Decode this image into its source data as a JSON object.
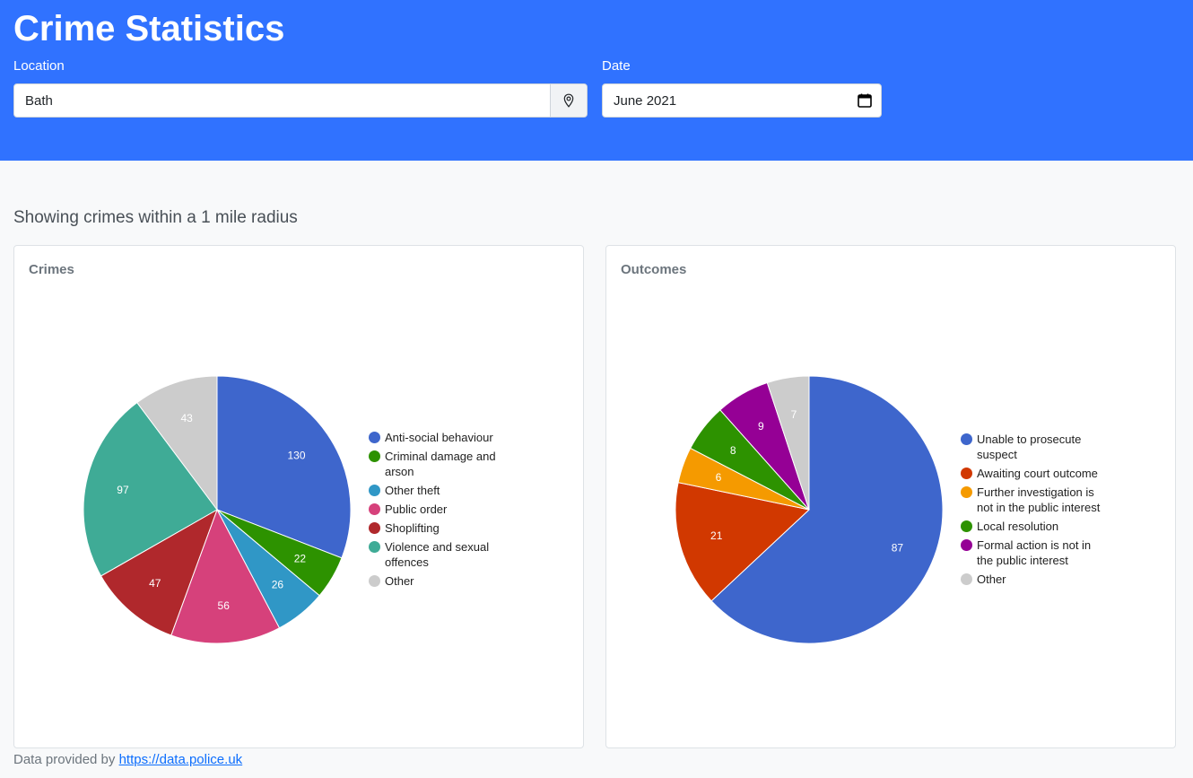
{
  "header": {
    "title": "Crime Statistics",
    "location_label": "Location",
    "location_value": "Bath",
    "date_label": "Date",
    "date_value": "June 2021"
  },
  "main": {
    "subtitle": "Showing crimes within a 1 mile radius"
  },
  "footer": {
    "text": "Data provided by",
    "link_text": "https://data.police.uk"
  },
  "icons": {
    "location": "map-pin-icon",
    "date": "calendar-icon"
  },
  "colors": {
    "header": "#3072ff"
  },
  "chart_data": [
    {
      "type": "pie",
      "title": "Crimes",
      "categories": [
        "Anti-social behaviour",
        "Criminal damage and arson",
        "Other theft",
        "Public order",
        "Shoplifting",
        "Violence and sexual offences",
        "Other"
      ],
      "values": [
        130,
        22,
        26,
        56,
        47,
        97,
        43
      ],
      "colors": [
        "#3e66cc",
        "#2d9200",
        "#3097c6",
        "#d6417b",
        "#b0282c",
        "#3fab96",
        "#cccccc"
      ],
      "legend": "right"
    },
    {
      "type": "pie",
      "title": "Outcomes",
      "categories": [
        "Unable to prosecute suspect",
        "Awaiting court outcome",
        "Further investigation is not in the public interest",
        "Local resolution",
        "Formal action is not in the public interest",
        "Other"
      ],
      "values": [
        87,
        21,
        6,
        8,
        9,
        7
      ],
      "colors": [
        "#3e66cc",
        "#d13800",
        "#f59a00",
        "#2d9200",
        "#950095",
        "#cccccc"
      ],
      "legend": "right"
    }
  ]
}
